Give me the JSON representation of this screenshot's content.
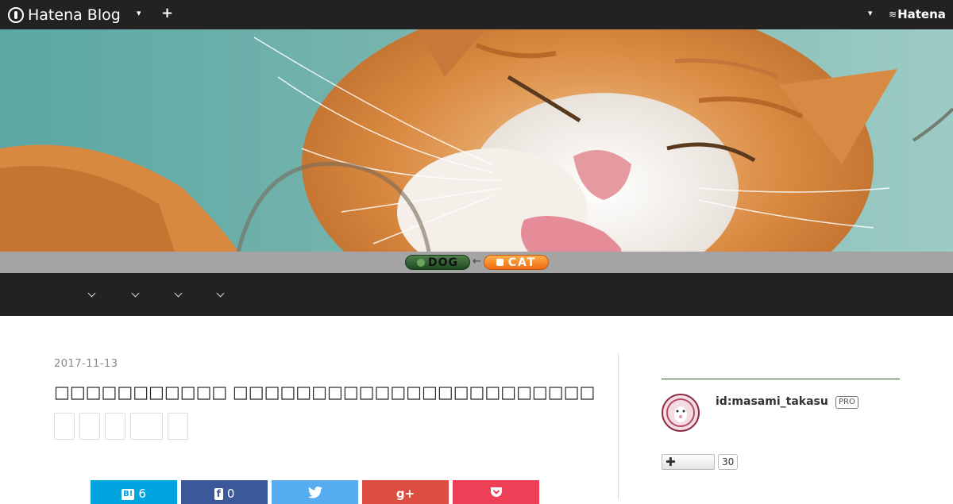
{
  "globalbar": {
    "logo_text": "Hatena Blog",
    "plus_label": "+",
    "caret": "▾",
    "hatena_text": "Hatena",
    "icons": [
      "hatena-blog-logo-icon",
      "chevron-down-icon",
      "plus-icon",
      "hatena-logo-icon"
    ]
  },
  "switcher": {
    "dog_label": "DOG",
    "arrow": "←",
    "cat_label": "CAT",
    "colors": {
      "dog": "#2f5f2c",
      "cat": "#f7851f"
    }
  },
  "nav": {
    "items": [
      {
        "label": "",
        "icon": "chevron-down-icon"
      },
      {
        "label": "",
        "icon": "chevron-down-icon"
      },
      {
        "label": "",
        "icon": "chevron-down-icon"
      },
      {
        "label": "",
        "icon": "chevron-down-icon"
      }
    ]
  },
  "entry": {
    "date": "2017-11-13",
    "title": "□□□□□□□□□□□ □□□□□□□□□□□□□□□□□□□□□□□",
    "category_count": 5,
    "share": {
      "hatena_count": "6",
      "facebook_count": "0",
      "hatena_icon_text": "B!",
      "facebook_icon_text": "f",
      "twitter_icon": "twitter-icon",
      "googleplus_label": "g+",
      "pocket_icon": "pocket-icon",
      "colors": {
        "hatena": "#00a4de",
        "facebook": "#3b5998",
        "twitter": "#55acee",
        "googleplus": "#dc4e41",
        "pocket": "#ef3f56"
      }
    }
  },
  "sidebar": {
    "user_id": "id:masami_takasu",
    "pro_badge": "PRO",
    "follow_plus": "✚",
    "follower_count": "30",
    "accent_color": "#2e5d2e"
  }
}
